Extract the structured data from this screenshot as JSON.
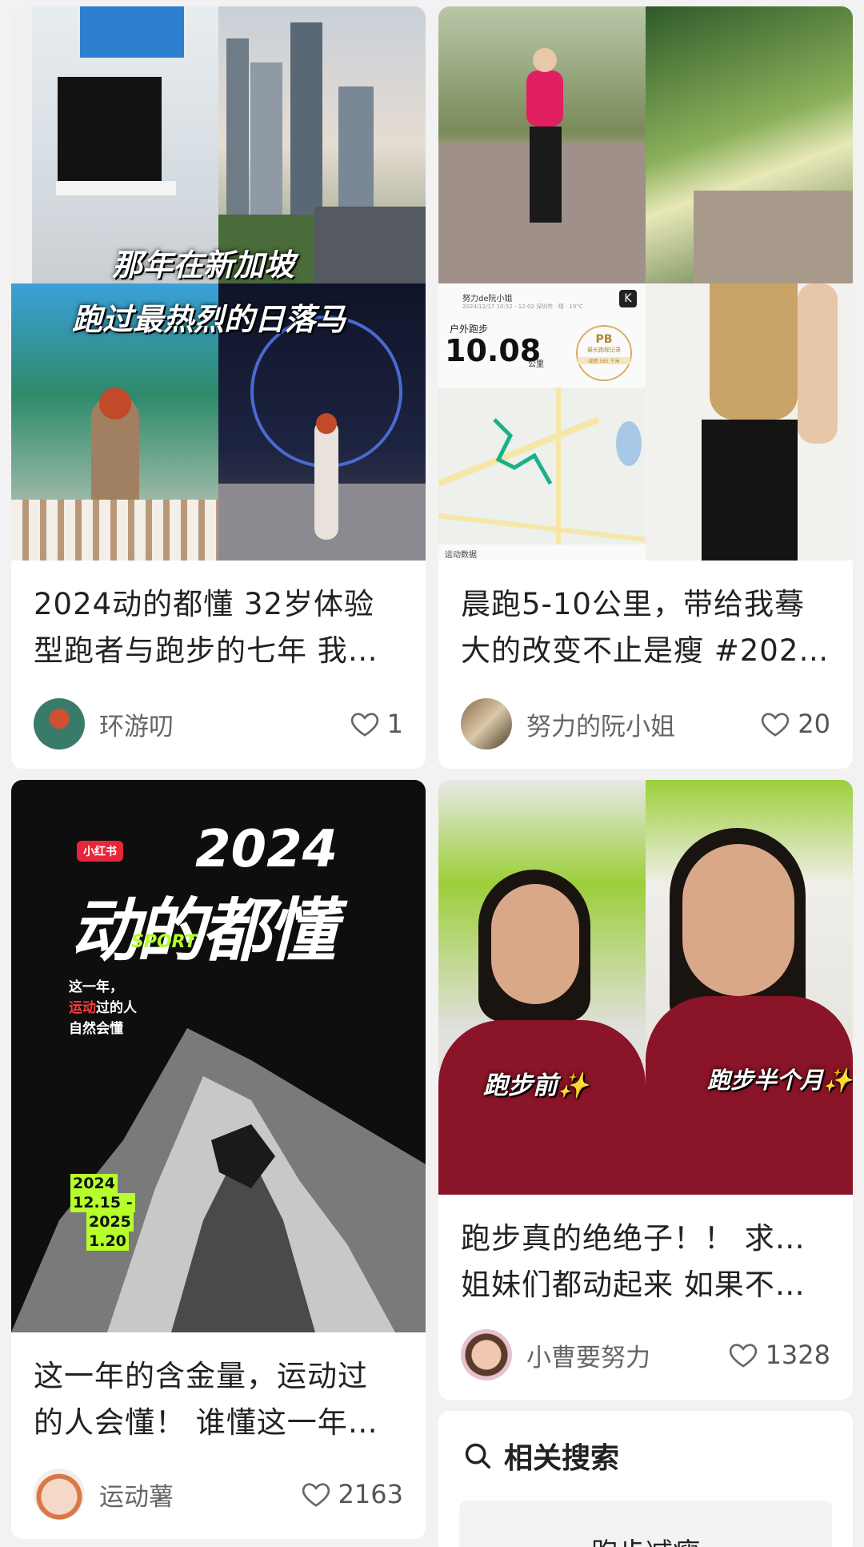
{
  "cards": [
    {
      "title_line1": "2024动的都懂 32岁体验",
      "title_line2": "型跑者与跑步的七年 我…",
      "author": "环游叨",
      "likes": "1",
      "image_caption_1": "那年在新加坡",
      "image_caption_2": "跑过最热烈的日落马"
    },
    {
      "title_line1": "晨跑5-10公里，带给我蓦",
      "title_line2": "大的改变不止是瘦 #202…",
      "author": "努力的阮小姐",
      "likes": "20",
      "run_user": "努力de阮小姐",
      "run_date": "2024/12/17 10:52 - 12:02 深圳市 · 晴 · 19°C",
      "run_label": "户外跑步",
      "run_distance": "10.08",
      "run_unit": "公里",
      "pb_badge": "PB",
      "pb_sub": "最长跑程记录",
      "pb_detail": "成绩 565 千米",
      "run_footer": "运动数据"
    },
    {
      "title_line1": "这一年的含金量，运动过",
      "title_line2": "的人会懂！ 谁懂这一年…",
      "author": "运动薯",
      "likes": "2163",
      "brand_tag": "小红书",
      "poster_year": "2024",
      "poster_title": "动的都懂",
      "poster_sport": "SPORT",
      "poster_line1": "这一年，",
      "poster_line2_hl": "运动",
      "poster_line2_rest": "过的人",
      "poster_line3": "自然会懂",
      "date_1": "2024",
      "date_2": "12.15 -",
      "date_3": "2025",
      "date_4": "1.20"
    },
    {
      "title_line1": "跑步真的绝绝子！！ 求求了",
      "title_line2": "姐妹们都动起来 如果不…",
      "author": "小曹要努力",
      "likes": "1328",
      "before_label": "跑步前✨",
      "after_label": "跑步半个月✨"
    }
  ],
  "related": {
    "heading": "相关搜索",
    "chip": "跑步减瘦"
  }
}
